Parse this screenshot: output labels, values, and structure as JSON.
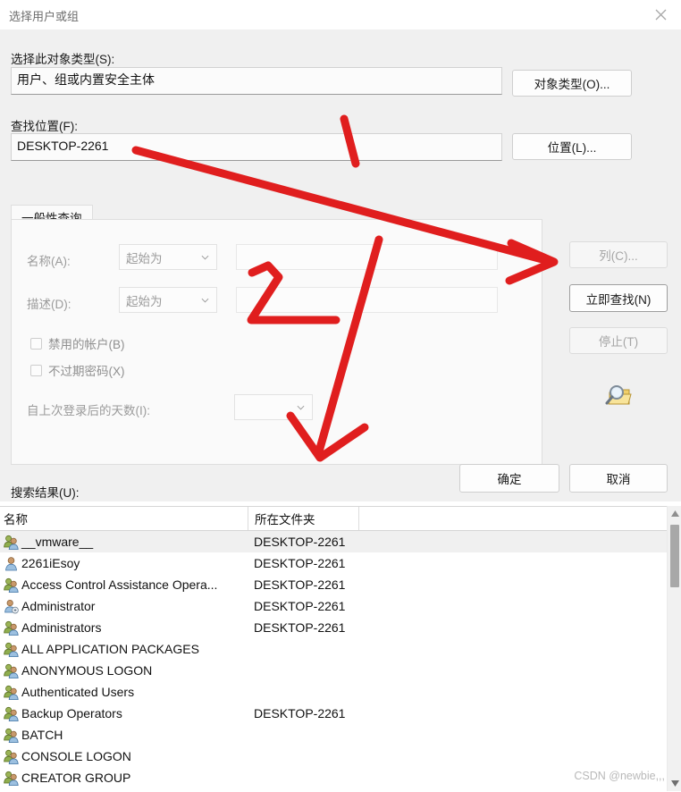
{
  "window": {
    "title": "选择用户或组",
    "close_icon": "close-icon"
  },
  "form": {
    "object_type_label": "选择此对象类型(S):",
    "object_type_value": "用户、组或内置安全主体",
    "object_type_button": "对象类型(O)...",
    "location_label": "查找位置(F):",
    "location_value": "DESKTOP-2261",
    "location_button": "位置(L)..."
  },
  "query": {
    "tab_label": "一般性查询",
    "name_label": "名称(A):",
    "name_operator": "起始为",
    "name_value": "",
    "description_label": "描述(D):",
    "description_operator": "起始为",
    "description_value": "",
    "disabled_accounts_label": "禁用的帐户(B)",
    "non_expiring_password_label": "不过期密码(X)",
    "days_since_logon_label": "自上次登录后的天数(I):",
    "days_since_logon_value": ""
  },
  "side_buttons": {
    "columns": "列(C)...",
    "find_now": "立即查找(N)",
    "stop": "停止(T)",
    "search_icon": "magnifier-folder-icon"
  },
  "footer": {
    "ok": "确定",
    "cancel": "取消"
  },
  "results": {
    "label": "搜索结果(U):",
    "columns": [
      "名称",
      "所在文件夹",
      ""
    ],
    "rows": [
      {
        "icon": "group-icon",
        "name": "__vmware__",
        "folder": "DESKTOP-2261",
        "selected": true
      },
      {
        "icon": "user-icon",
        "name": "2261iEsoy",
        "folder": "DESKTOP-2261",
        "selected": false
      },
      {
        "icon": "group-icon",
        "name": "Access Control Assistance Opera...",
        "folder": "DESKTOP-2261",
        "selected": false
      },
      {
        "icon": "admin-icon",
        "name": "Administrator",
        "folder": "DESKTOP-2261",
        "selected": false
      },
      {
        "icon": "group-icon",
        "name": "Administrators",
        "folder": "DESKTOP-2261",
        "selected": false
      },
      {
        "icon": "group-icon",
        "name": "ALL APPLICATION PACKAGES",
        "folder": "",
        "selected": false
      },
      {
        "icon": "group-icon",
        "name": "ANONYMOUS LOGON",
        "folder": "",
        "selected": false
      },
      {
        "icon": "group-icon",
        "name": "Authenticated Users",
        "folder": "",
        "selected": false
      },
      {
        "icon": "group-icon",
        "name": "Backup Operators",
        "folder": "DESKTOP-2261",
        "selected": false
      },
      {
        "icon": "group-icon",
        "name": "BATCH",
        "folder": "",
        "selected": false
      },
      {
        "icon": "group-icon",
        "name": "CONSOLE LOGON",
        "folder": "",
        "selected": false
      },
      {
        "icon": "group-icon",
        "name": "CREATOR GROUP",
        "folder": "",
        "selected": false
      }
    ]
  },
  "annotations": {
    "color": "#E01E1E",
    "marks": [
      {
        "name": "step-1",
        "label": "1"
      },
      {
        "name": "step-2",
        "label": "2"
      }
    ]
  },
  "watermark": "CSDN @newbie,,,"
}
